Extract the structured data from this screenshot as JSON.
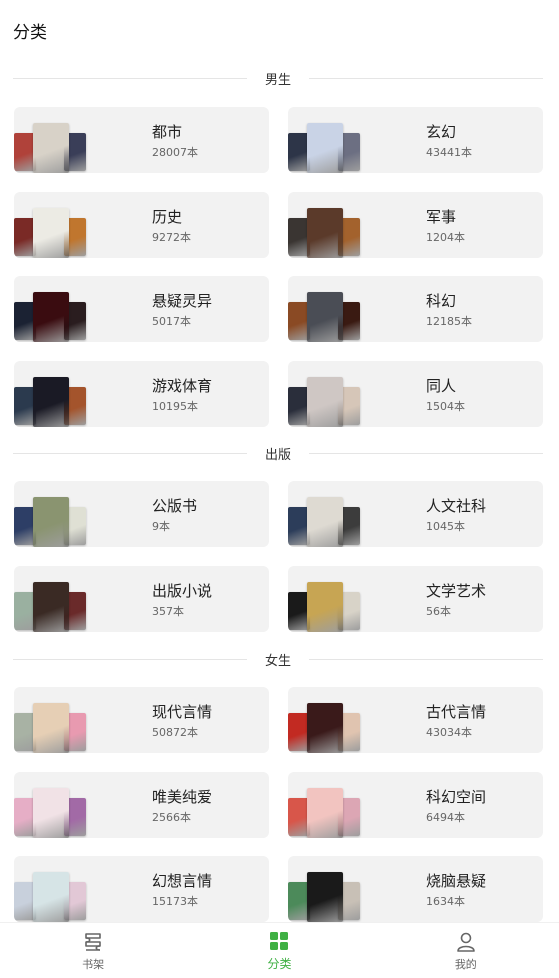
{
  "header": {
    "title": "分类"
  },
  "sections": [
    {
      "label": "男生",
      "items": [
        {
          "name": "都市",
          "count": "28007本",
          "colors": [
            "#b0423a",
            "#d8d2c8",
            "#3a3e58"
          ]
        },
        {
          "name": "玄幻",
          "count": "43441本",
          "colors": [
            "#2d3548",
            "#c9d3e6",
            "#6c6f82"
          ]
        },
        {
          "name": "历史",
          "count": "9272本",
          "colors": [
            "#7a2a26",
            "#ecebe4",
            "#c0762e"
          ]
        },
        {
          "name": "军事",
          "count": "1204本",
          "colors": [
            "#3a3532",
            "#5b3a2a",
            "#a3622d"
          ]
        },
        {
          "name": "悬疑灵异",
          "count": "5017本",
          "colors": [
            "#1b2233",
            "#3a0c10",
            "#2a1d1f"
          ]
        },
        {
          "name": "科幻",
          "count": "12185本",
          "colors": [
            "#8a4a24",
            "#4a4d55",
            "#3a1a12"
          ]
        },
        {
          "name": "游戏体育",
          "count": "10195本",
          "colors": [
            "#2b3a4e",
            "#1a1a25",
            "#a4542c"
          ]
        },
        {
          "name": "同人",
          "count": "1504本",
          "colors": [
            "#2a2e3b",
            "#cfc7c4",
            "#d6c6b8"
          ]
        }
      ]
    },
    {
      "label": "出版",
      "items": [
        {
          "name": "公版书",
          "count": "9本",
          "colors": [
            "#2d3e66",
            "#8a9470",
            "#dfe0d4"
          ]
        },
        {
          "name": "人文社科",
          "count": "1045本",
          "colors": [
            "#2c3d5a",
            "#dedad2",
            "#3c3c3c"
          ]
        },
        {
          "name": "出版小说",
          "count": "357本",
          "colors": [
            "#9ab0a0",
            "#3a2a24",
            "#6a2a2a"
          ]
        },
        {
          "name": "文学艺术",
          "count": "56本",
          "colors": [
            "#1a1a1a",
            "#c7a553",
            "#d8d3c8"
          ]
        }
      ]
    },
    {
      "label": "女生",
      "items": [
        {
          "name": "现代言情",
          "count": "50872本",
          "colors": [
            "#a8b2a4",
            "#e6cfb5",
            "#e89ab0"
          ]
        },
        {
          "name": "古代言情",
          "count": "43034本",
          "colors": [
            "#c22a22",
            "#3a1a1a",
            "#e0c4b0"
          ]
        },
        {
          "name": "唯美纯爱",
          "count": "2566本",
          "colors": [
            "#e6aec6",
            "#f1e2e6",
            "#a26aa6"
          ]
        },
        {
          "name": "科幻空间",
          "count": "6494本",
          "colors": [
            "#d8564a",
            "#f2c4c0",
            "#dca6b4"
          ]
        },
        {
          "name": "幻想言情",
          "count": "15173本",
          "colors": [
            "#c8d0dc",
            "#d6e4e6",
            "#e2c8d6"
          ]
        },
        {
          "name": "烧脑悬疑",
          "count": "1634本",
          "colors": [
            "#4c8a5a",
            "#1a1a1a",
            "#c8c0b6"
          ]
        }
      ]
    }
  ],
  "tabbar": {
    "tabs": [
      {
        "label": "书架",
        "icon": "bookshelf-icon",
        "active": false
      },
      {
        "label": "分类",
        "icon": "category-grid-icon",
        "active": true
      },
      {
        "label": "我的",
        "icon": "person-icon",
        "active": false
      }
    ],
    "accent": "#3fb043"
  }
}
